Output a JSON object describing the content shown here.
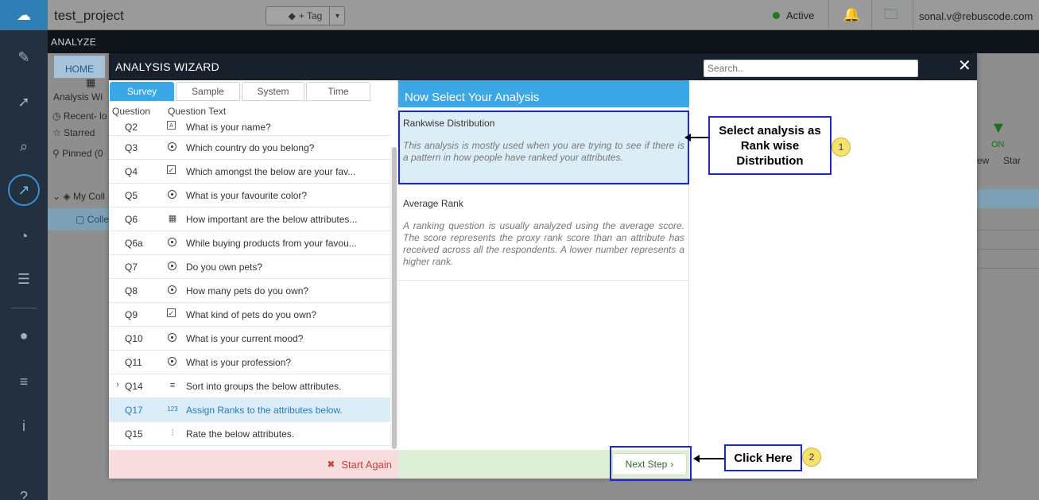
{
  "app": {
    "project_name": "test_project",
    "tag_label": "+ Tag",
    "status": "Active",
    "user_email": "sonal.v@rebuscode.com",
    "section": "ANALYZE"
  },
  "background": {
    "home_tab": "HOME",
    "analysis_wizard_short": "Analysis Wi",
    "recent": "Recent- lo",
    "starred": "Starred",
    "pinned": "Pinned (0",
    "my_collection": "My Coll",
    "collection": "Colle",
    "filter_on": "ON",
    "col_view": "ew",
    "col_star": "Star"
  },
  "wizard": {
    "title": "ANALYSIS WIZARD",
    "search_placeholder": "Search..",
    "close": "✕",
    "tabs": [
      "Survey",
      "Sample",
      "System",
      "Time"
    ],
    "col_question": "Question",
    "col_question_text": "Question Text",
    "questions": [
      {
        "id": "Q2",
        "icon": "text",
        "text": "What is your name?"
      },
      {
        "id": "Q3",
        "icon": "radio",
        "text": "Which country do you belong?"
      },
      {
        "id": "Q4",
        "icon": "check",
        "text": "Which amongst the below are your fav..."
      },
      {
        "id": "Q5",
        "icon": "radio",
        "text": "What is your favourite color?"
      },
      {
        "id": "Q6",
        "icon": "grid",
        "text": "How important are the below attributes..."
      },
      {
        "id": "Q6a",
        "icon": "radio",
        "text": "While buying products from your favou..."
      },
      {
        "id": "Q7",
        "icon": "radio",
        "text": "Do you own pets?"
      },
      {
        "id": "Q8",
        "icon": "radio",
        "text": "How many pets do you own?"
      },
      {
        "id": "Q9",
        "icon": "check",
        "text": "What kind of pets do you own?"
      },
      {
        "id": "Q10",
        "icon": "radio",
        "text": "What is your current mood?"
      },
      {
        "id": "Q11",
        "icon": "radio",
        "text": "What is your profession?"
      },
      {
        "id": "Q14",
        "icon": "sort",
        "text": "Sort into groups the below attributes."
      },
      {
        "id": "Q17",
        "icon": "rank",
        "text": "Assign Ranks to the attributes below."
      },
      {
        "id": "Q15",
        "icon": "rate",
        "text": "Rate the below attributes."
      }
    ],
    "start_again": "Start Again",
    "analysis_header": "Now Select Your Analysis",
    "analyses": [
      {
        "title": "Rankwise Distribution",
        "desc": "This analysis is mostly used when you are trying to see if there is a pattern in how people have ranked your attributes."
      },
      {
        "title": "Average Rank",
        "desc": "A ranking question is usually analyzed using the average score. The score represents the proxy rank score than an attribute has received across all the respondents. A lower number represents a higher rank."
      }
    ],
    "next_step": "Next Step"
  },
  "callouts": {
    "one_text": "Select analysis as Rank wise Distribution",
    "one_num": "1",
    "two_text": "Click Here",
    "two_num": "2"
  },
  "colors": {
    "accent_blue": "#3ba7e6",
    "selected_bg": "#dbeef8",
    "callout_border": "#1a28d6",
    "badge_yellow": "#f7e36b"
  }
}
